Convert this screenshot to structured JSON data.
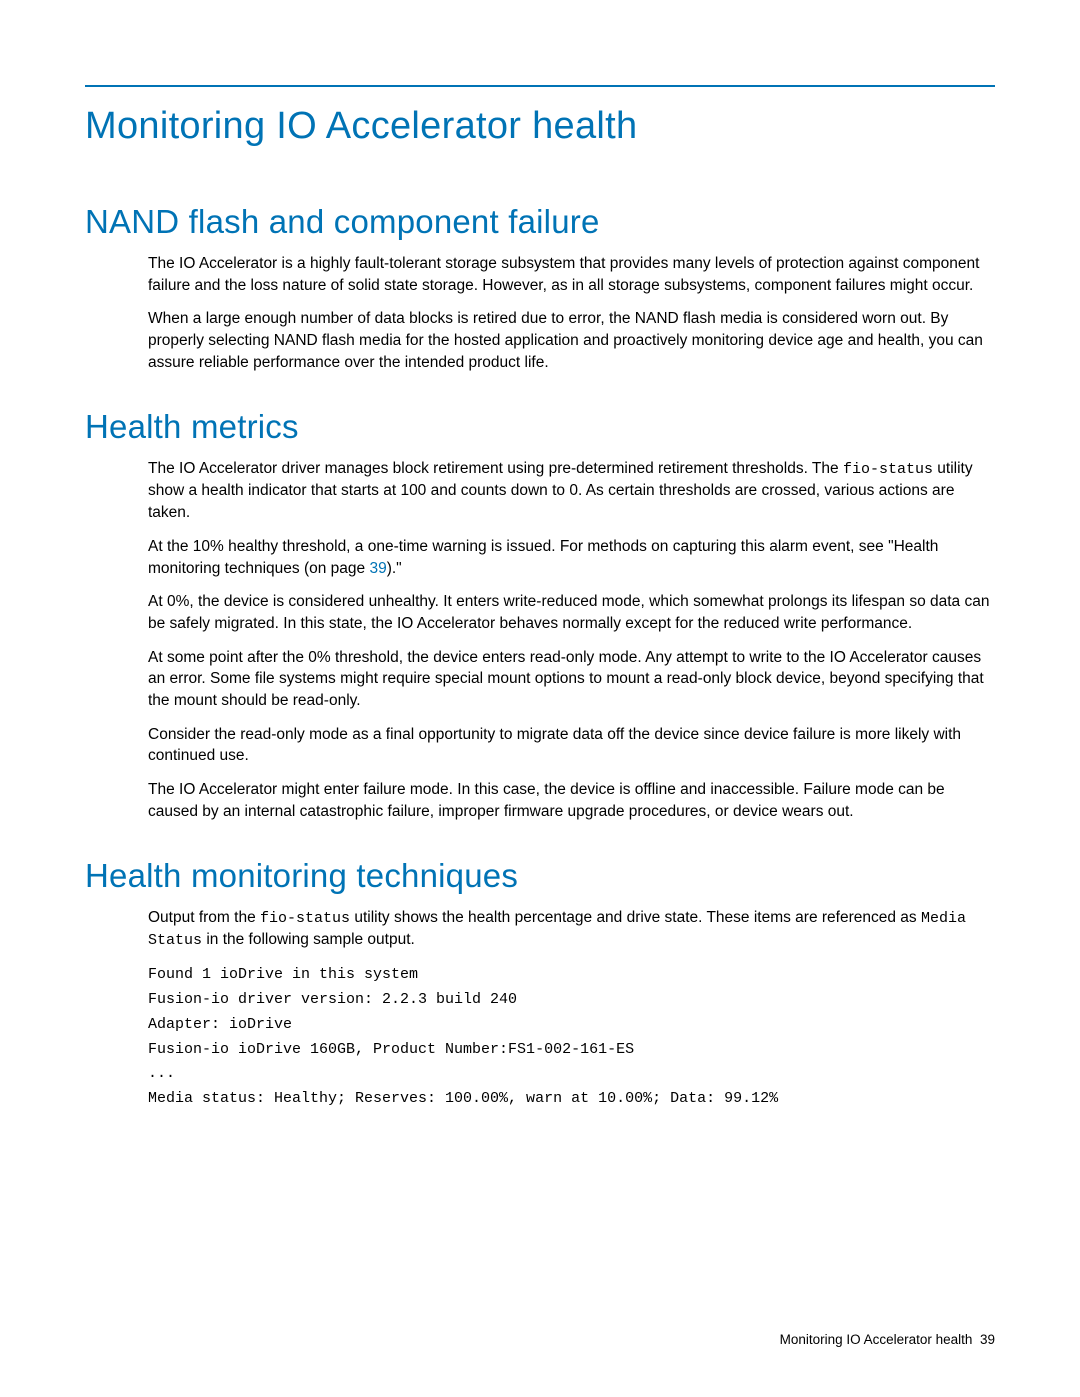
{
  "title": "Monitoring IO Accelerator health",
  "sections": {
    "nand": {
      "heading": "NAND flash and component failure",
      "p1": "The IO Accelerator is a highly fault-tolerant storage subsystem that provides many levels of protection against component failure and the loss nature of solid state storage. However, as in all storage subsystems, component failures might occur.",
      "p2": "When a large enough number of data blocks is retired due to error, the NAND flash media is considered worn out. By properly selecting NAND flash media for the hosted application and proactively monitoring device age and health, you can assure reliable performance over the intended product life."
    },
    "metrics": {
      "heading": "Health metrics",
      "p1a": "The IO Accelerator driver manages block retirement using pre-determined retirement thresholds. The ",
      "p1code": "fio-status",
      "p1b": " utility show a health indicator that starts at 100 and counts down to 0. As certain thresholds are crossed, various actions are taken.",
      "p2a": "At the 10% healthy threshold, a one-time warning is issued. For methods on capturing this alarm event, see \"Health monitoring techniques (on page ",
      "p2link": "39",
      "p2b": ").\"",
      "p3": "At 0%, the device is considered unhealthy. It enters write-reduced mode, which somewhat prolongs its lifespan so data can be safely migrated. In this state, the IO Accelerator behaves normally except for the reduced write performance.",
      "p4": "At some point after the 0% threshold, the device enters read-only mode. Any attempt to write to the IO Accelerator causes an error. Some file systems might require special mount options to mount a read-only block device, beyond specifying that the mount should be read-only.",
      "p5": "Consider the read-only mode as a final opportunity to migrate data off the device since device failure is more likely with continued use.",
      "p6": "The IO Accelerator might enter failure mode. In this case, the device is offline and inaccessible. Failure mode can be caused by an internal catastrophic failure, improper firmware upgrade procedures, or device wears out."
    },
    "techniques": {
      "heading": "Health monitoring techniques",
      "p1a": "Output from the ",
      "p1code1": "fio-status",
      "p1b": " utility shows the health percentage and drive state. These items are referenced as ",
      "p1code2": "Media Status",
      "p1c": " in the following sample output.",
      "code": "Found 1 ioDrive in this system\nFusion-io driver version: 2.2.3 build 240\nAdapter: ioDrive\nFusion-io ioDrive 160GB, Product Number:FS1-002-161-ES\n...\nMedia status: Healthy; Reserves: 100.00%, warn at 10.00%; Data: 99.12%"
    }
  },
  "footer": {
    "text": "Monitoring IO Accelerator health",
    "page": "39"
  }
}
